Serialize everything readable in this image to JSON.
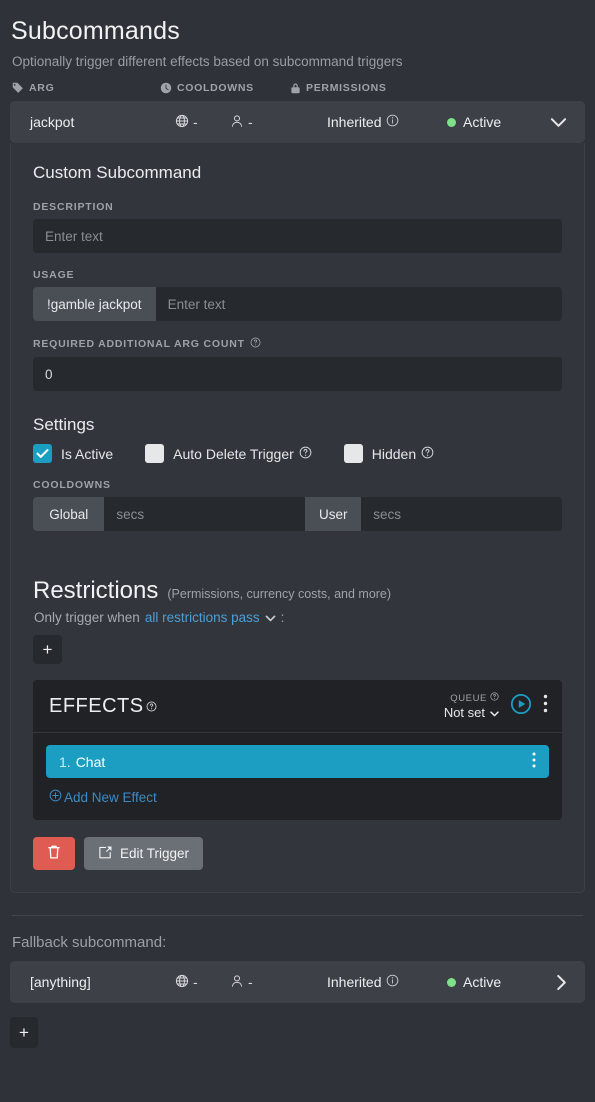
{
  "header": {
    "title": "Subcommands",
    "subtitle": "Optionally trigger different effects based on subcommand triggers",
    "columns": [
      {
        "label": "ARG",
        "icon": "tag-icon"
      },
      {
        "label": "COOLDOWNS",
        "icon": "clock-icon"
      },
      {
        "label": "PERMISSIONS",
        "icon": "lock-icon"
      }
    ]
  },
  "subcommand_row": {
    "arg": "jackpot",
    "global_cooldown": "-",
    "user_cooldown": "-",
    "permission": "Inherited",
    "status": "Active",
    "status_color": "#7fe08a",
    "chevron": "chevron-down-icon"
  },
  "detail": {
    "title": "Custom Subcommand",
    "description_label": "DESCRIPTION",
    "description_value": "",
    "description_placeholder": "Enter text",
    "usage_label": "USAGE",
    "usage_prefix": "!gamble jackpot",
    "usage_value": "",
    "usage_placeholder": "Enter text",
    "arg_count_label": "REQUIRED ADDITIONAL ARG COUNT",
    "arg_count_value": "0",
    "settings_title": "Settings",
    "checkboxes": [
      {
        "label": "Is Active",
        "checked": true,
        "help": false
      },
      {
        "label": "Auto Delete Trigger",
        "checked": false,
        "help": true
      },
      {
        "label": "Hidden",
        "checked": false,
        "help": true
      }
    ],
    "cooldowns_label": "COOLDOWNS",
    "cooldown_global_label": "Global",
    "cooldown_global_value": "",
    "cooldown_global_placeholder": "secs",
    "cooldown_user_label": "User",
    "cooldown_user_value": "",
    "cooldown_user_placeholder": "secs"
  },
  "restrictions": {
    "title": "Restrictions",
    "note": "(Permissions, currency costs, and more)",
    "prefix_text": "Only trigger when",
    "mode": "all restrictions pass",
    "suffix_text": ":",
    "add_label": "+",
    "link_color": "#4c9fd6"
  },
  "effects": {
    "title": "EFFECTS",
    "queue_label": "QUEUE",
    "queue_value": "Not set",
    "play_icon": "play-circle-icon",
    "menu_icon": "kebab-menu-icon",
    "items": [
      {
        "index": "1.",
        "name": "Chat",
        "color": "#1b9ec2"
      }
    ],
    "add_label": "Add New Effect"
  },
  "actions": {
    "delete_icon": "trash-icon",
    "edit_icon": "edit-pencil-icon",
    "edit_label": "Edit Trigger"
  },
  "fallback": {
    "label": "Fallback subcommand:",
    "arg": "[anything]",
    "global_cooldown": "-",
    "user_cooldown": "-",
    "permission": "Inherited",
    "status": "Active",
    "chevron": "chevron-right-icon"
  },
  "bottom_add": {
    "label": "+"
  }
}
